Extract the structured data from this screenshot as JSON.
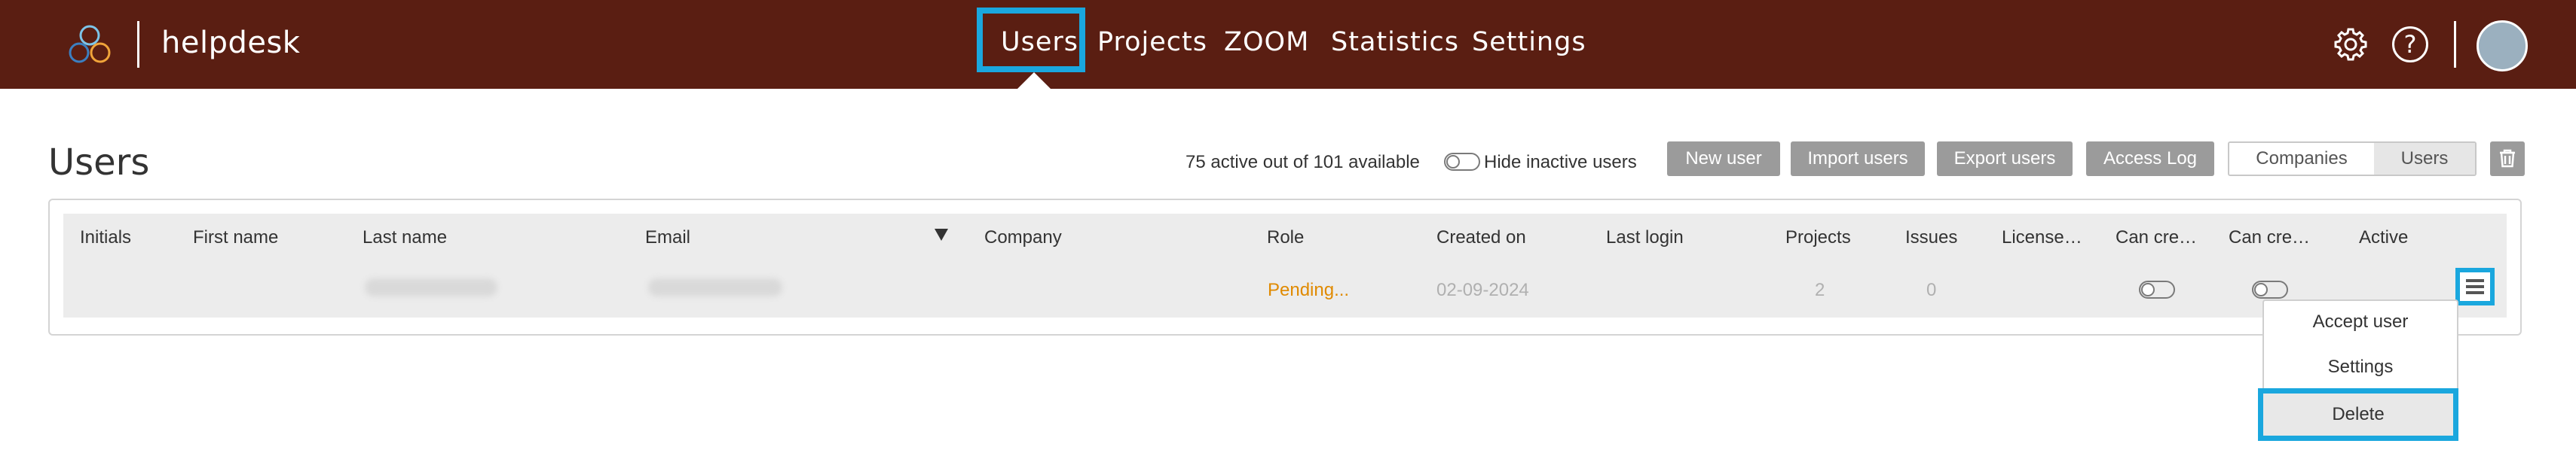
{
  "app": {
    "name": "helpdesk"
  },
  "nav": {
    "items": [
      {
        "label": "Users",
        "active": true
      },
      {
        "label": "Projects"
      },
      {
        "label": "ZOOM"
      },
      {
        "label": "Statistics"
      },
      {
        "label": "Settings"
      }
    ]
  },
  "header_icons": {
    "settings_icon": "gear-icon",
    "help_glyph": "?",
    "avatar_color": "#9bb0bf"
  },
  "page": {
    "title": "Users",
    "active_count": "75 active out of 101 available",
    "hide_inactive_label": "Hide inactive users",
    "hide_inactive_on": false
  },
  "toolbar": {
    "new_user": "New user",
    "import_users": "Import users",
    "export_users": "Export users",
    "access_log": "Access Log",
    "segment": [
      "Companies",
      "Users"
    ],
    "segment_selected": "Users",
    "delete_icon": "trash-icon"
  },
  "table": {
    "columns": [
      "Initials",
      "First name",
      "Last name",
      "Email",
      "Company",
      "Role",
      "Created on",
      "Last login",
      "Projects",
      "Issues",
      "License…",
      "Can cre…",
      "Can cre…",
      "Active"
    ],
    "sorted_by": "Email",
    "rows": [
      {
        "initials": "",
        "first_name": "",
        "last_name_redacted": true,
        "email_redacted": true,
        "company": "",
        "role": "Pending...",
        "created_on": "02-09-2024",
        "last_login": "",
        "projects": "2",
        "issues": "0"
      }
    ]
  },
  "row_menu": {
    "items": [
      "Accept user",
      "Settings",
      "Delete"
    ],
    "highlighted": "Delete"
  },
  "colors": {
    "topbar": "#5a1e12",
    "highlight": "#1aa7de",
    "pending": "#e08a00",
    "button_grey": "#9b9b9b"
  }
}
